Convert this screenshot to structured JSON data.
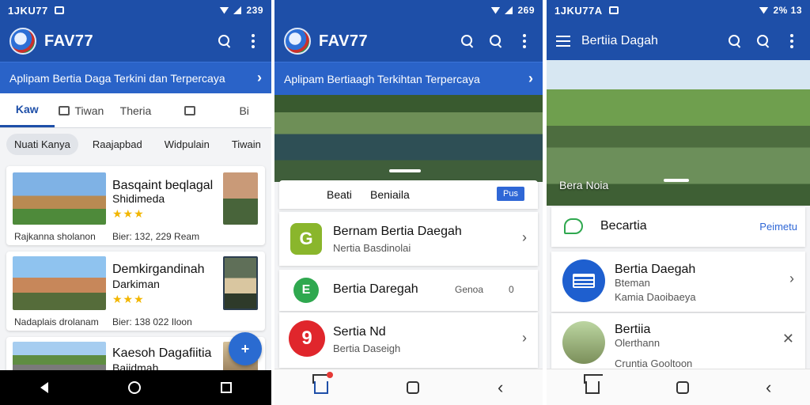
{
  "colors": {
    "primary": "#1e4fa8",
    "accent": "#2a63c8",
    "star": "#f2b600"
  },
  "screen1": {
    "status": {
      "left": "1JKU77",
      "right": "239"
    },
    "brand": "FAV77",
    "banner": "Aplipam Bertia Daga Terkini dan Terpercaya",
    "tabs": [
      "Kaw",
      "Tiwan",
      "Theria",
      "",
      "Bi"
    ],
    "chips": [
      "Nuati Kanya",
      "Raajapbad",
      "Widpulain",
      "Tiwain"
    ],
    "cards": [
      {
        "title": "Basqaint beqlagal",
        "title2": "Shidimeda",
        "stars": "★★★",
        "meta_left": "Rajkanna sholanon",
        "meta_right": "Bier: 132, 229 Ream"
      },
      {
        "title": "Demkirgandinah",
        "title2": "Darkiman",
        "stars": "★★★",
        "meta_left": "Nadaplais drolanam",
        "meta_right": "Bier: 138 022 Iloon"
      },
      {
        "title": "Kaesoh Dagafiitia",
        "title2": "Bajidmah",
        "stars": "",
        "meta_left": "",
        "meta_right": ""
      }
    ],
    "fab_icon": "add-icon"
  },
  "screen2": {
    "status": {
      "right": "269"
    },
    "brand": "FAV77",
    "banner": "Aplipam Bertiaagh Terkihtan Terpercaya",
    "tabbar": {
      "left": "Beati",
      "right": "Beniaila",
      "pill": "Pus"
    },
    "items": [
      {
        "title": "Bernam Bertia Daegah",
        "subtitle": "Nertia Basdinolai",
        "icon_letter": "G",
        "icon_color": "#8ab62c"
      },
      {
        "title": "Bertia Daregah",
        "subtitle": "",
        "icon_letter": "E",
        "icon_color": "#2fa84f",
        "meta": "Genoa",
        "meta_num": "0"
      },
      {
        "title": "Sertia Nd",
        "subtitle": "Bertia Daseigh",
        "icon_letter": "9",
        "icon_color": "#e0262c"
      }
    ]
  },
  "screen3": {
    "status": {
      "left": "1JKU77A",
      "right": "2% 13"
    },
    "title": "Bertiia Dagah",
    "hero_label": "Bera Noia",
    "header_row": {
      "label": "Becartia",
      "link": "Peimetu"
    },
    "items": [
      {
        "title": "Bertia Daegah",
        "line2": "Bteman",
        "line3": "Kamia Daoibaeya",
        "action": "›"
      },
      {
        "title": "Bertiia",
        "line2": "Olerthann",
        "line3": "Cruntia Gooltoon",
        "action": "✕"
      }
    ]
  }
}
